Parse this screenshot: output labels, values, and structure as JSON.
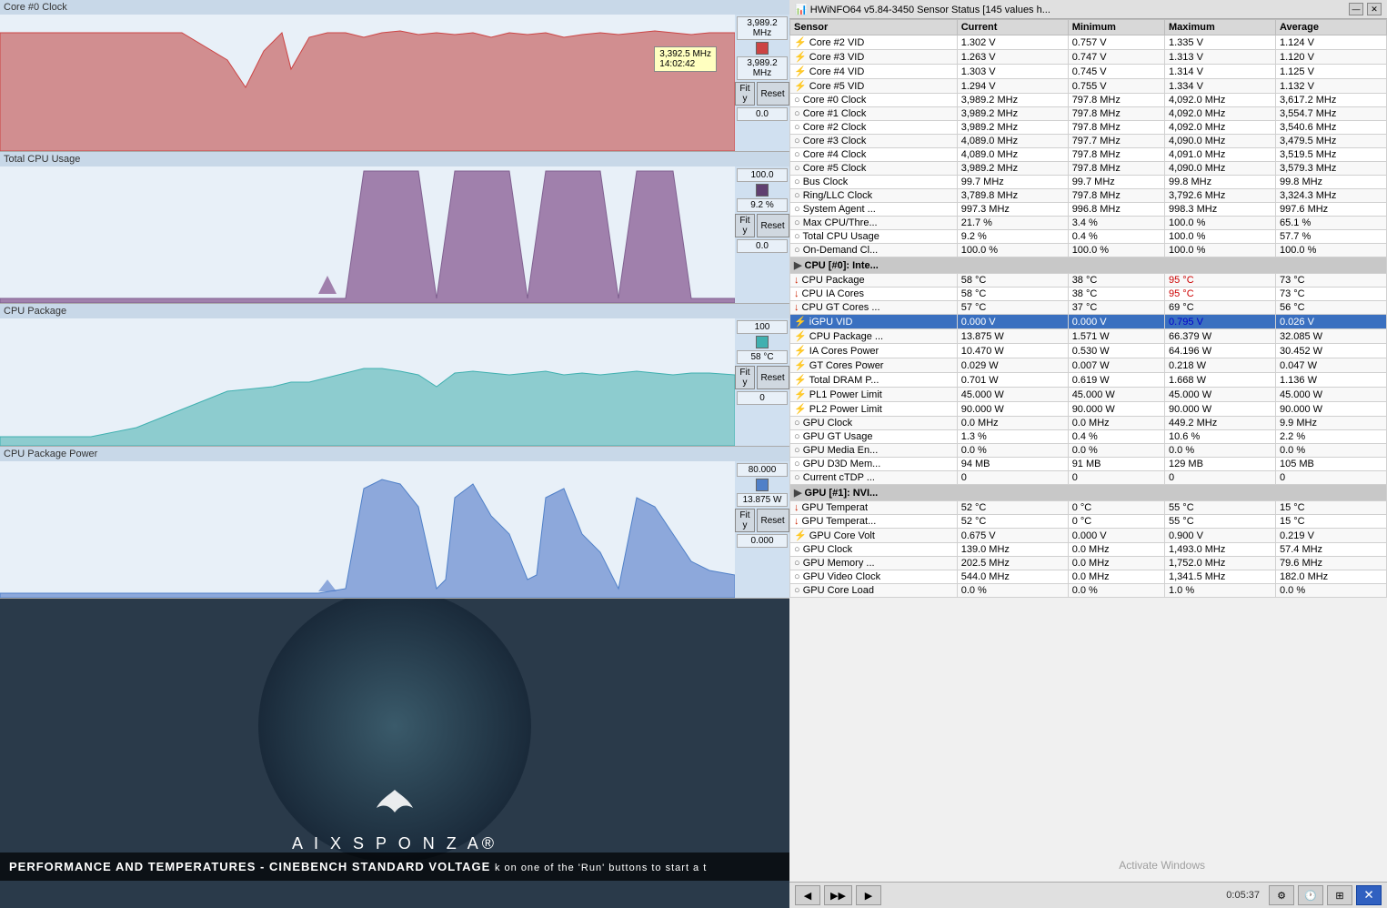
{
  "left": {
    "charts": [
      {
        "id": "core-clock",
        "title": "Core #0 Clock",
        "current_value": "3,989.2 MHz",
        "second_value": "3,989.2 MHz",
        "tooltip_value": "3,392.5 MHz",
        "tooltip_time": "14:02:42",
        "fit_label": "Fit y",
        "reset_label": "Reset",
        "min_label": "0.0",
        "color": "#e08080"
      },
      {
        "id": "cpu-usage",
        "title": "Total CPU Usage",
        "current_value": "100.0",
        "second_value": "9.2 %",
        "fit_label": "Fit y",
        "reset_label": "Reset",
        "min_label": "0.0",
        "color": "#806090"
      },
      {
        "id": "cpu-package",
        "title": "CPU Package",
        "current_value": "100",
        "second_value": "58 °C",
        "fit_label": "Fit y",
        "reset_label": "Reset",
        "min_label": "0",
        "color": "#60c0c0"
      },
      {
        "id": "cpu-power",
        "title": "CPU Package Power",
        "current_value": "80.000",
        "second_value": "13.875 W",
        "fit_label": "Fit y",
        "reset_label": "Reset",
        "min_label": "0.000",
        "color": "#6090d0"
      }
    ],
    "bottom_text": "PERFORMANCE AND TEMPERATURES - CINEBENCH STANDARD VOLTAGE",
    "bottom_subtext": "k on one of the 'Run' buttons to start a t"
  },
  "right": {
    "title": "HWiNFO64 v5.84-3450 Sensor Status [145 values h...",
    "columns": [
      "Sensor",
      "Current",
      "Minimum",
      "Maximum",
      "Average"
    ],
    "rows": [
      {
        "icon": "volt",
        "name": "Core #2 VID",
        "current": "1.302 V",
        "minimum": "0.757 V",
        "maximum": "1.335 V",
        "average": "1.124 V"
      },
      {
        "icon": "volt",
        "name": "Core #3 VID",
        "current": "1.263 V",
        "minimum": "0.747 V",
        "maximum": "1.313 V",
        "average": "1.120 V"
      },
      {
        "icon": "volt",
        "name": "Core #4 VID",
        "current": "1.303 V",
        "minimum": "0.745 V",
        "maximum": "1.314 V",
        "average": "1.125 V"
      },
      {
        "icon": "volt",
        "name": "Core #5 VID",
        "current": "1.294 V",
        "minimum": "0.755 V",
        "maximum": "1.334 V",
        "average": "1.132 V"
      },
      {
        "icon": "clock",
        "name": "Core #0 Clock",
        "current": "3,989.2 MHz",
        "minimum": "797.8 MHz",
        "maximum": "4,092.0 MHz",
        "average": "3,617.2 MHz"
      },
      {
        "icon": "clock",
        "name": "Core #1 Clock",
        "current": "3,989.2 MHz",
        "minimum": "797.8 MHz",
        "maximum": "4,092.0 MHz",
        "average": "3,554.7 MHz"
      },
      {
        "icon": "clock",
        "name": "Core #2 Clock",
        "current": "3,989.2 MHz",
        "minimum": "797.8 MHz",
        "maximum": "4,092.0 MHz",
        "average": "3,540.6 MHz"
      },
      {
        "icon": "clock",
        "name": "Core #3 Clock",
        "current": "4,089.0 MHz",
        "minimum": "797.7 MHz",
        "maximum": "4,090.0 MHz",
        "average": "3,479.5 MHz"
      },
      {
        "icon": "clock",
        "name": "Core #4 Clock",
        "current": "4,089.0 MHz",
        "minimum": "797.8 MHz",
        "maximum": "4,091.0 MHz",
        "average": "3,519.5 MHz"
      },
      {
        "icon": "clock",
        "name": "Core #5 Clock",
        "current": "3,989.2 MHz",
        "minimum": "797.8 MHz",
        "maximum": "4,090.0 MHz",
        "average": "3,579.3 MHz"
      },
      {
        "icon": "clock",
        "name": "Bus Clock",
        "current": "99.7 MHz",
        "minimum": "99.7 MHz",
        "maximum": "99.8 MHz",
        "average": "99.8 MHz"
      },
      {
        "icon": "clock",
        "name": "Ring/LLC Clock",
        "current": "3,789.8 MHz",
        "minimum": "797.8 MHz",
        "maximum": "3,792.6 MHz",
        "average": "3,324.3 MHz"
      },
      {
        "icon": "clock",
        "name": "System Agent ...",
        "current": "997.3 MHz",
        "minimum": "996.8 MHz",
        "maximum": "998.3 MHz",
        "average": "997.6 MHz"
      },
      {
        "icon": "clock",
        "name": "Max CPU/Thre...",
        "current": "21.7 %",
        "minimum": "3.4 %",
        "maximum": "100.0 %",
        "average": "65.1 %"
      },
      {
        "icon": "clock",
        "name": "Total CPU Usage",
        "current": "9.2 %",
        "minimum": "0.4 %",
        "maximum": "100.0 %",
        "average": "57.7 %"
      },
      {
        "icon": "clock",
        "name": "On-Demand Cl...",
        "current": "100.0 %",
        "minimum": "100.0 %",
        "maximum": "100.0 %",
        "average": "100.0 %"
      },
      {
        "type": "section",
        "name": "CPU [#0]: Inte...",
        "icon": "section"
      },
      {
        "icon": "thermo",
        "name": "CPU Package",
        "current": "58 °C",
        "minimum": "38 °C",
        "maximum_red": "95 °C",
        "average": "73 °C"
      },
      {
        "icon": "thermo",
        "name": "CPU IA Cores",
        "current": "58 °C",
        "minimum": "38 °C",
        "maximum_red": "95 °C",
        "average": "73 °C"
      },
      {
        "icon": "thermo",
        "name": "CPU GT Cores ...",
        "current": "57 °C",
        "minimum": "37 °C",
        "maximum": "69 °C",
        "average": "56 °C"
      },
      {
        "icon": "volt",
        "name": "iGPU VID",
        "current": "0.000 V",
        "minimum": "0.000 V",
        "maximum_blue": "0.795 V",
        "average": "0.026 V",
        "highlighted": true
      },
      {
        "icon": "power",
        "name": "CPU Package ...",
        "current": "13.875 W",
        "minimum": "1.571 W",
        "maximum": "66.379 W",
        "average": "32.085 W"
      },
      {
        "icon": "power",
        "name": "IA Cores Power",
        "current": "10.470 W",
        "minimum": "0.530 W",
        "maximum": "64.196 W",
        "average": "30.452 W"
      },
      {
        "icon": "power",
        "name": "GT Cores Power",
        "current": "0.029 W",
        "minimum": "0.007 W",
        "maximum": "0.218 W",
        "average": "0.047 W"
      },
      {
        "icon": "power",
        "name": "Total DRAM P...",
        "current": "0.701 W",
        "minimum": "0.619 W",
        "maximum": "1.668 W",
        "average": "1.136 W"
      },
      {
        "icon": "power",
        "name": "PL1 Power Limit",
        "current": "45.000 W",
        "minimum": "45.000 W",
        "maximum": "45.000 W",
        "average": "45.000 W"
      },
      {
        "icon": "power",
        "name": "PL2 Power Limit",
        "current": "90.000 W",
        "minimum": "90.000 W",
        "maximum": "90.000 W",
        "average": "90.000 W"
      },
      {
        "icon": "clock",
        "name": "GPU Clock",
        "current": "0.0 MHz",
        "minimum": "0.0 MHz",
        "maximum": "449.2 MHz",
        "average": "9.9 MHz"
      },
      {
        "icon": "clock",
        "name": "GPU GT Usage",
        "current": "1.3 %",
        "minimum": "0.4 %",
        "maximum": "10.6 %",
        "average": "2.2 %"
      },
      {
        "icon": "clock",
        "name": "GPU Media En...",
        "current": "0.0 %",
        "minimum": "0.0 %",
        "maximum": "0.0 %",
        "average": "0.0 %"
      },
      {
        "icon": "clock",
        "name": "GPU D3D Mem...",
        "current": "94 MB",
        "minimum": "91 MB",
        "maximum": "129 MB",
        "average": "105 MB"
      },
      {
        "icon": "clock",
        "name": "Current cTDP ...",
        "current": "0",
        "minimum": "0",
        "maximum": "0",
        "average": "0"
      },
      {
        "type": "section",
        "name": "GPU [#1]: NVI...",
        "icon": "section"
      },
      {
        "icon": "thermo",
        "name": "GPU Temperat",
        "current": "52 °C",
        "minimum": "0 °C",
        "maximum": "55 °C",
        "average": "15 °C"
      },
      {
        "icon": "thermo",
        "name": "GPU Temperat...",
        "current": "52 °C",
        "minimum": "0 °C",
        "maximum": "55 °C",
        "average": "15 °C"
      },
      {
        "icon": "volt",
        "name": "GPU Core Volt",
        "current": "0.675 V",
        "minimum": "0.000 V",
        "maximum": "0.900 V",
        "average": "0.219 V"
      },
      {
        "icon": "clock",
        "name": "GPU Clock",
        "current": "139.0 MHz",
        "minimum": "0.0 MHz",
        "maximum": "1,493.0 MHz",
        "average": "57.4 MHz"
      },
      {
        "icon": "clock",
        "name": "GPU Memory ...",
        "current": "202.5 MHz",
        "minimum": "0.0 MHz",
        "maximum": "1,752.0 MHz",
        "average": "79.6 MHz"
      },
      {
        "icon": "clock",
        "name": "GPU Video Clock",
        "current": "544.0 MHz",
        "minimum": "0.0 MHz",
        "maximum": "1,341.5 MHz",
        "average": "182.0 MHz"
      },
      {
        "icon": "clock",
        "name": "GPU Core Load",
        "current": "0.0 %",
        "minimum": "0.0 %",
        "maximum": "1.0 %",
        "average": "0.0 %"
      }
    ],
    "toolbar": {
      "back_label": "◀",
      "forward_label": "▶▶",
      "forward2_label": "▶",
      "time": "0:05:37",
      "settings_label": "⚙",
      "clock_label": "🕐",
      "windows_label": "⊞",
      "close_label": "✕"
    }
  }
}
